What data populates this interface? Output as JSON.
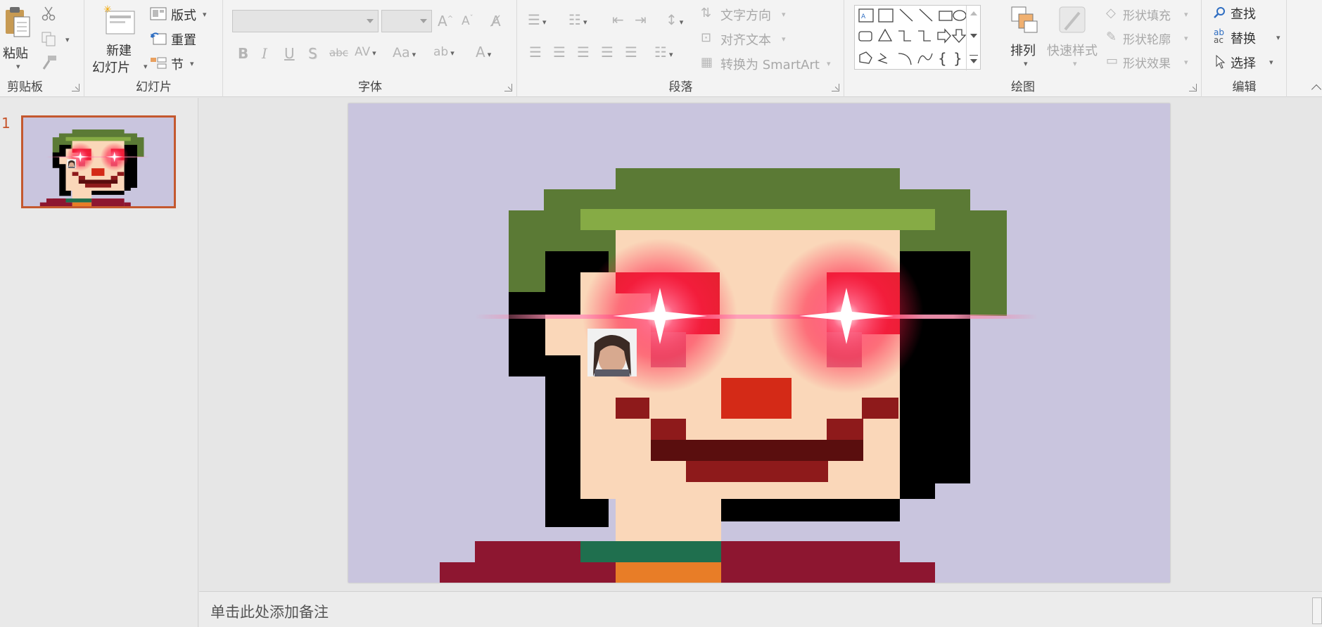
{
  "ribbon": {
    "clipboard": {
      "paste": "粘贴",
      "group": "剪贴板"
    },
    "slides": {
      "new_slide_line1": "新建",
      "new_slide_line2": "幻灯片",
      "layout": "版式",
      "reset": "重置",
      "section": "节",
      "group": "幻灯片"
    },
    "font": {
      "group": "字体"
    },
    "paragraph": {
      "text_direction": "文字方向",
      "align_text": "对齐文本",
      "convert_smartart": "转换为 SmartArt",
      "group": "段落"
    },
    "drawing": {
      "arrange": "排列",
      "quick_styles": "快速样式",
      "shape_fill": "形状填充",
      "shape_outline": "形状轮廓",
      "shape_effects": "形状效果",
      "group": "绘图"
    },
    "editing": {
      "find": "查找",
      "replace": "替换",
      "select": "选择",
      "group": "编辑"
    }
  },
  "thumbnails": {
    "slide_number": "1"
  },
  "notes": {
    "placeholder": "单击此处添加备注"
  },
  "colors": {
    "accent": "#c4582f",
    "slide_bg": "#c9c5de"
  }
}
